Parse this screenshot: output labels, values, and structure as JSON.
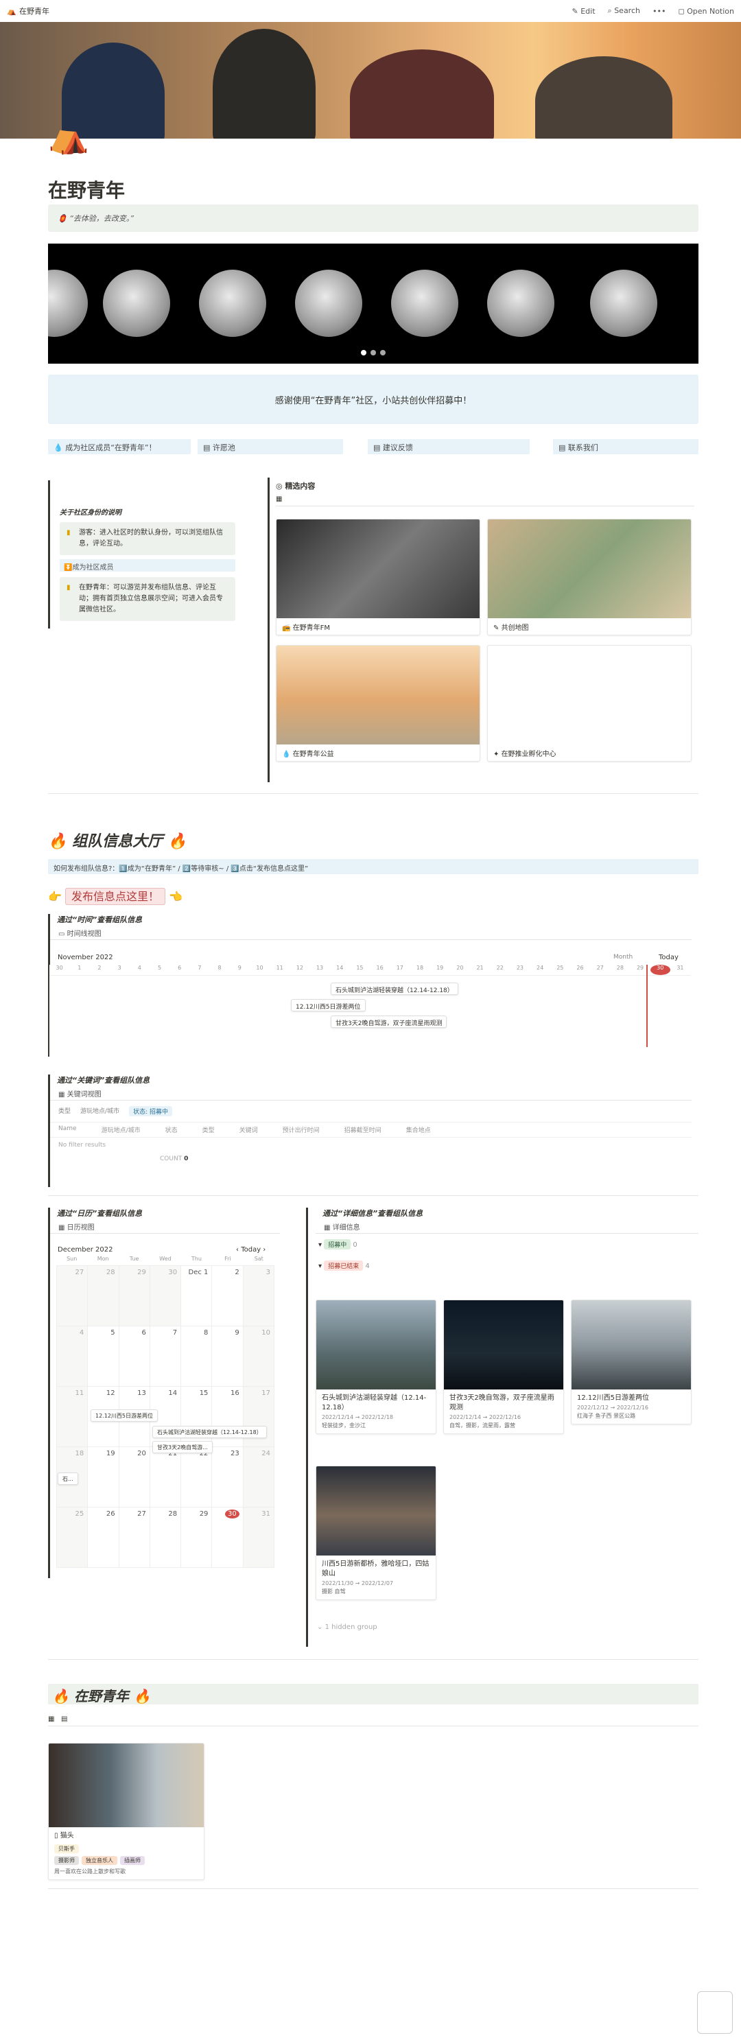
{
  "topbar": {
    "page_title": "在野青年",
    "edit": "Edit",
    "search": "Search",
    "more": "•••",
    "open_notion": "Open Notion"
  },
  "page": {
    "title": "在野青年",
    "quote": "“去体验，去改变。”"
  },
  "welcome": "感谢使用“在野青年”社区，小站共创伙伴招募中！",
  "nav": [
    "成为社区成员“在野青年”！",
    "许愿池",
    "建议反馈",
    "联系我们"
  ],
  "sidebar": {
    "heading": "关于社区身份的说明",
    "callout1": "游客：进入社区时的默认身份，可以浏览组队信息，评论互动。",
    "callout1_strong": "游客",
    "join_link": "⏬成为社区成员",
    "callout2": "在野青年：可以游览并发布组队信息、评论互动；拥有首页独立信息展示空间；可进入会员专属微信社区。",
    "callout2_strong": "在野青年"
  },
  "featured": {
    "heading": "精选内容",
    "cards": [
      {
        "label": "在野青年FM",
        "color": "#4a4a4a"
      },
      {
        "label": "共创地图",
        "color": "#c9b18b"
      },
      {
        "label": "在野青年公益",
        "color": "#e2a970"
      },
      {
        "label": "在野推业孵化中心",
        "color": "#ffffff"
      }
    ]
  },
  "hall": {
    "title": "组队信息大厅",
    "info_bar": "如何发布组队信息?：1️⃣成为“在野青年” / 2️⃣等待审核~ / 3️⃣点击“发布信息点这里”",
    "publish": "发布信息点这里！"
  },
  "timeline": {
    "heading": "通过“时间”查看组队信息",
    "tab": "时间线视图",
    "month": "November 2022",
    "scale": "Month",
    "today": "Today",
    "days": [
      "30",
      "1",
      "2",
      "3",
      "4",
      "5",
      "6",
      "7",
      "8",
      "9",
      "10",
      "11",
      "12",
      "13",
      "14",
      "15",
      "16",
      "17",
      "18",
      "19",
      "20",
      "21",
      "22",
      "23",
      "24",
      "25",
      "26",
      "27",
      "28",
      "29",
      "30",
      "31"
    ],
    "bars": [
      "石头城到泸沽湖轻装穿越（12.14-12.18）",
      "12.12川西5日游差两位",
      "甘孜3天2晚自驾游，双子座流星雨观测"
    ]
  },
  "keyword": {
    "heading": "通过“关键词”查看组队信息",
    "tab": "关键词视图",
    "filters": [
      "类型",
      "游玩地点/城市",
      "状态: 招募中"
    ],
    "columns": [
      "Name",
      "游玩地点/城市",
      "状态",
      "类型",
      "关键词",
      "预计出行时间",
      "招募截至时间",
      "集合地点"
    ],
    "empty": "No filter results",
    "count_label": "COUNT",
    "count": "0"
  },
  "calendar": {
    "heading": "通过“日历”查看组队信息",
    "tab": "日历视图",
    "month": "December 2022",
    "today": "Today",
    "weekdays": [
      "Sun",
      "Mon",
      "Tue",
      "Wed",
      "Thu",
      "Fri",
      "Sat"
    ],
    "weeks": [
      [
        "27",
        "28",
        "29",
        "30",
        "Dec 1",
        "2",
        "3"
      ],
      [
        "4",
        "5",
        "6",
        "7",
        "8",
        "9",
        "10"
      ],
      [
        "11",
        "12",
        "13",
        "14",
        "15",
        "16",
        "17"
      ],
      [
        "18",
        "19",
        "20",
        "21",
        "22",
        "23",
        "24"
      ],
      [
        "25",
        "26",
        "27",
        "28",
        "29",
        "30",
        "31"
      ]
    ],
    "events": [
      "12.12川西5日游差两位",
      "石头城到泸沽湖轻装穿越（12.14-12.18）",
      "甘孜3天2晚自驾游...",
      "石..."
    ]
  },
  "gallery": {
    "heading": "通过“详细信息”查看组队信息",
    "tab": "详细信息",
    "group1": {
      "label": "招募中",
      "count": "0"
    },
    "group2": {
      "label": "招募已结束",
      "count": "4"
    },
    "cards": [
      {
        "title": "石头城到泸沽湖轻装穿越（12.14-12.18）",
        "date": "2022/12/14 → 2022/12/18",
        "tags": "轻装徒步，金沙江",
        "color": "#596b6e"
      },
      {
        "title": "甘孜3天2晚自驾游，双子座流星雨观测",
        "date": "2022/12/14 → 2022/12/16",
        "tags": "自驾，摄影，流星雨，露营",
        "color": "#1e2a33"
      },
      {
        "title": "12.12川西5日游差两位",
        "date": "2022/12/12 → 2022/12/16",
        "tags": "红海子 鱼子西 景区公路",
        "color": "#8f9aa0"
      },
      {
        "title": "川西5日游新都桥，雅哈垭口，四姑娘山",
        "date": "2022/11/30 → 2022/12/07",
        "tags": "摄影 自驾",
        "color": "#7b6a5a"
      }
    ],
    "hidden": "1 hidden group"
  },
  "members": {
    "title": "在野青年",
    "card": {
      "name": "猫头",
      "role": "贝斯手",
      "tags": [
        "摄影师",
        "独立音乐人",
        "插画师"
      ],
      "note": "周一喜欢在公路上散步和写歌",
      "color": "#5a6a72"
    }
  }
}
